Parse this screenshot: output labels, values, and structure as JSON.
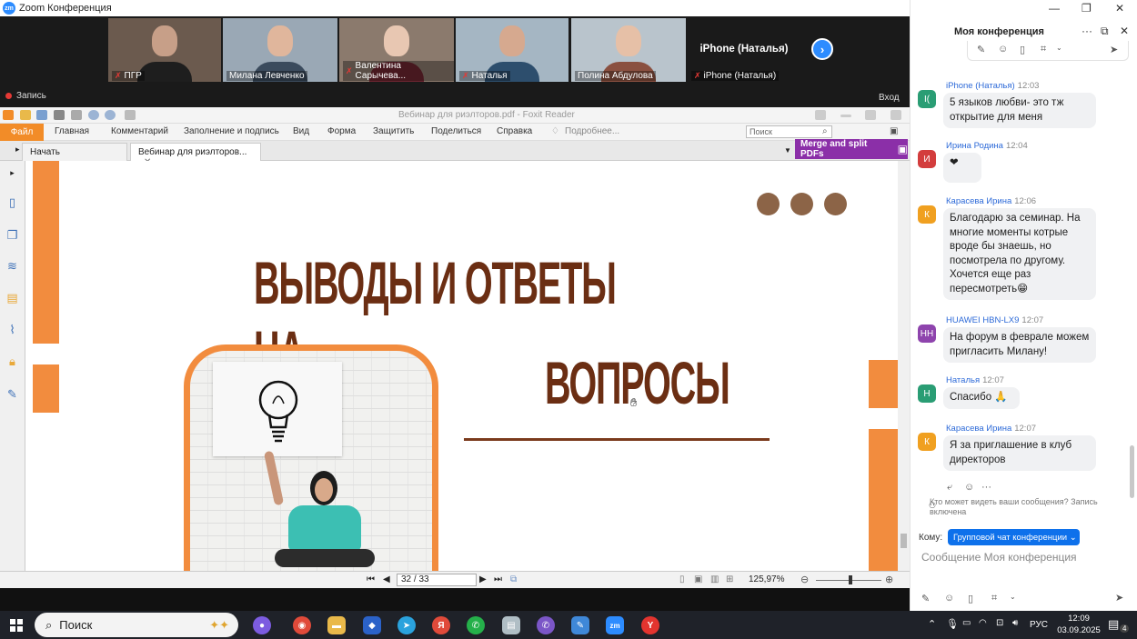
{
  "window": {
    "title": "Zoom Конференция"
  },
  "zoom": {
    "record_label": "Запись",
    "exit_label": "Вход",
    "participants": [
      {
        "name": "ПГР",
        "muted": true,
        "bg": "#6b5a4e",
        "face": "#c79f88",
        "body": "#1e1e1e"
      },
      {
        "name": "Милана Левченко",
        "muted": false,
        "bg": "#9aa8b5",
        "face": "#e0b69c",
        "body": "#3b4b5d"
      },
      {
        "name": "Валентина Сарычева...",
        "muted": true,
        "bg": "#8b7a6d",
        "face": "#e8c7b2",
        "body": "#6d2531"
      },
      {
        "name": "Наталья",
        "muted": true,
        "bg": "#a5b6c3",
        "face": "#d6a98f",
        "body": "#2d4e6d"
      },
      {
        "name": "Полина Абдулова",
        "muted": false,
        "bg": "#b9c4cc",
        "face": "#e6c0a7",
        "body": "#8a5040"
      },
      {
        "name": "iPhone (Наталья)",
        "muted": true,
        "big_name": "iPhone (Наталья)"
      }
    ]
  },
  "foxit": {
    "doc_title": "Вебинар для риэлторов.pdf - Foxit Reader",
    "menu": {
      "file": "Файл",
      "items": [
        "Главная",
        "Комментарий",
        "Заполнение и подпись",
        "Вид",
        "Форма",
        "Защитить",
        "Поделиться",
        "Справка"
      ],
      "more": "Подробнее..."
    },
    "search_placeholder": "Поиск",
    "tabs": [
      "Начать",
      "Вебинар для риэлторов..."
    ],
    "merge_label": "Merge and split PDFs",
    "page_value": "32 / 33",
    "zoom_value": "125,97%"
  },
  "slide": {
    "heading_line1": "ВЫВОДЫ И ОТВЕТЫ НА",
    "heading_line2": "ВОПРОСЫ",
    "accent": "#f28c3e",
    "text_color": "#6b2e13"
  },
  "chat": {
    "title": "Моя конференция",
    "messages": [
      {
        "sender": "iPhone (Наталья)",
        "time": "12:03",
        "initials": "I(",
        "avatar_color": "#2a9d74",
        "text": "5 языков любви- это тж открытие для меня"
      },
      {
        "sender": "Ирина Родина",
        "time": "12:04",
        "initials": "И",
        "avatar_color": "#d33d3d",
        "text": "❤"
      },
      {
        "sender": "Карасева Ирина",
        "time": "12:06",
        "initials": "К",
        "avatar_color": "#f0a020",
        "text": "Благодарю за семинар. На многие моменты котрые вроде бы знаешь, но посмотрела по другому. Хочется еще раз пересмотреть😁"
      },
      {
        "sender": "HUAWEI HBN-LX9",
        "time": "12:07",
        "initials": "HH",
        "avatar_color": "#8e44ad",
        "text": "На форум в феврале можем пригласить Милану!"
      },
      {
        "sender": "Наталья",
        "time": "12:07",
        "initials": "Н",
        "avatar_color": "#2a9d74",
        "text": "Спасибо 🙏"
      },
      {
        "sender": "Карасева Ирина",
        "time": "12:07",
        "initials": "К",
        "avatar_color": "#f0a020",
        "text": "Я за приглашение в клуб директоров"
      }
    ],
    "visibility_note": "Кто может видеть ваши сообщения? Запись включена",
    "to_label": "Кому:",
    "to_value": "Групповой чат конференции ⌄",
    "input_placeholder": "Сообщение Моя конференция"
  },
  "taskbar": {
    "search_label": "Поиск",
    "lang": "РУС",
    "time": "12:09",
    "date": "03.09.2025",
    "notifications": "4"
  }
}
